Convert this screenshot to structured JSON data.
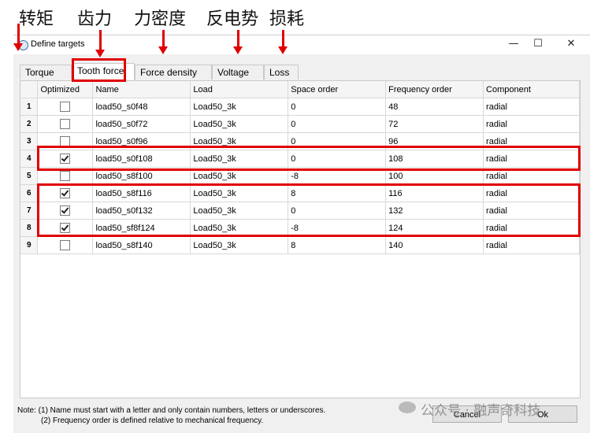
{
  "annotations": {
    "labels": [
      "转矩",
      "齿力",
      "力密度",
      "反电势",
      "损耗"
    ],
    "color": "#e00000"
  },
  "window": {
    "title": "Define targets",
    "icon": "app-icon",
    "controls": {
      "minimize": "—",
      "maximize": "☐",
      "close": "✕"
    }
  },
  "tabs": [
    "Torque",
    "Tooth force",
    "Force density",
    "Voltage",
    "Loss"
  ],
  "active_tab": "Tooth force",
  "table": {
    "headers": [
      "",
      "Optimized",
      "Name",
      "Load",
      "Space order",
      "Frequency order",
      "Component"
    ],
    "rows": [
      {
        "n": "1",
        "checked": false,
        "name": "load50_s0f48",
        "load": "Load50_3k",
        "space": "0",
        "freq": "48",
        "comp": "radial"
      },
      {
        "n": "2",
        "checked": false,
        "name": "load50_s0f72",
        "load": "Load50_3k",
        "space": "0",
        "freq": "72",
        "comp": "radial"
      },
      {
        "n": "3",
        "checked": false,
        "name": "load50_s0f96",
        "load": "Load50_3k",
        "space": "0",
        "freq": "96",
        "comp": "radial"
      },
      {
        "n": "4",
        "checked": true,
        "name": "load50_s0f108",
        "load": "Load50_3k",
        "space": "0",
        "freq": "108",
        "comp": "radial"
      },
      {
        "n": "5",
        "checked": false,
        "name": "load50_s8f100",
        "load": "Load50_3k",
        "space": "-8",
        "freq": "100",
        "comp": "radial"
      },
      {
        "n": "6",
        "checked": true,
        "name": "load50_s8f116",
        "load": "Load50_3k",
        "space": "8",
        "freq": "116",
        "comp": "radial"
      },
      {
        "n": "7",
        "checked": true,
        "name": "load50_s0f132",
        "load": "Load50_3k",
        "space": "0",
        "freq": "132",
        "comp": "radial"
      },
      {
        "n": "8",
        "checked": true,
        "name": "load50_sf8f124",
        "load": "Load50_3k",
        "space": "-8",
        "freq": "124",
        "comp": "radial"
      },
      {
        "n": "9",
        "checked": false,
        "name": "load50_s8f140",
        "load": "Load50_3k",
        "space": "8",
        "freq": "140",
        "comp": "radial"
      }
    ]
  },
  "notes": {
    "line1": "Note: (1) Name must start with a letter and only contain numbers, letters or underscores.",
    "line2": "(2) Frequency order is defined relative to mechanical frequency."
  },
  "buttons": {
    "cancel": "Cancel",
    "ok": "Ok"
  },
  "watermark": "公众号 · 融声奇科技"
}
